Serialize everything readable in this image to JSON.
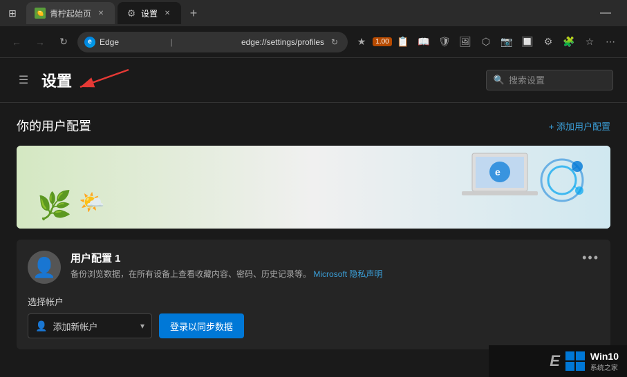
{
  "tabBar": {
    "tabs": [
      {
        "id": "tab-lemon",
        "label": "青柠起始页",
        "favicon": "🍋",
        "active": false
      },
      {
        "id": "tab-settings",
        "label": "设置",
        "favicon": "⚙",
        "active": true
      }
    ],
    "newTabIcon": "+",
    "minimizeLabel": "—"
  },
  "addressBar": {
    "backLabel": "←",
    "forwardLabel": "→",
    "refreshLabel": "↻",
    "brandLabel": "Edge",
    "addressText": "edge://settings/profiles",
    "favoriteIcon": "★",
    "badgeCount": "1.00"
  },
  "settingsHeader": {
    "menuIcon": "☰",
    "title": "设置",
    "searchPlaceholder": "搜索设置"
  },
  "profileSection": {
    "title": "你的用户配置",
    "addButtonLabel": "+ 添加用户配置",
    "profiles": [
      {
        "id": "profile-1",
        "name": "用户配置 1",
        "description": "备份浏览数据，在所有设备上查看收藏内容、密码、历史记录等。",
        "linkText": "Microsoft 隐私声明",
        "moreIcon": "•••"
      }
    ],
    "accountSection": {
      "label": "选择帐户",
      "selectPlaceholder": "添加新帐户",
      "syncButtonLabel": "登录以同步数据"
    }
  },
  "watermark": {
    "letter": "E",
    "win10Text": "Win10",
    "win10Sub": "系统之家"
  }
}
